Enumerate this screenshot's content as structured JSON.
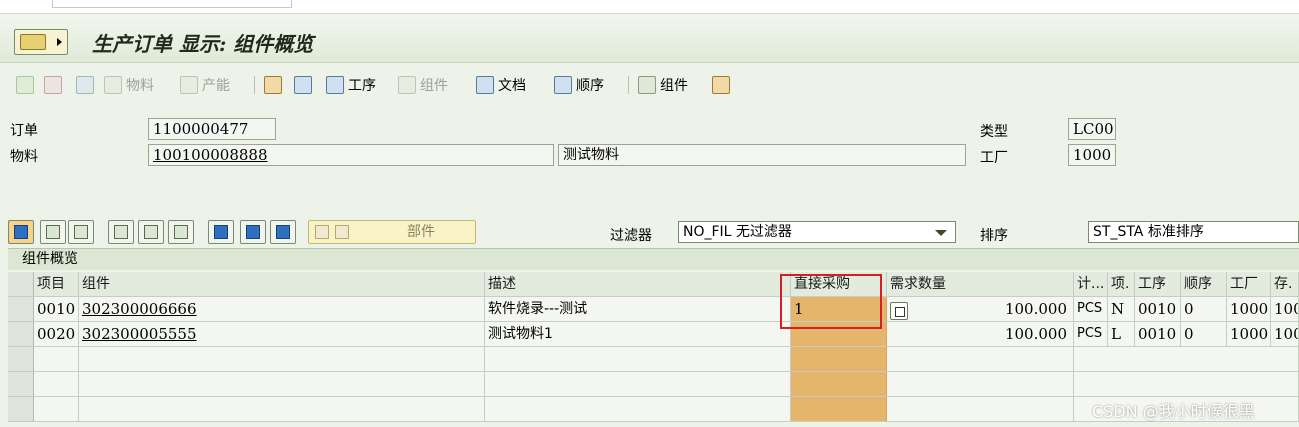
{
  "window": {
    "title": "生产订单 显示: 组件概览"
  },
  "toolbar": {
    "material_label": "物料",
    "capacity_label": "产能",
    "operation_label": "工序",
    "component_disabled_label": "组件",
    "document_label": "文档",
    "sequence_label": "顺序",
    "component_label": "组件"
  },
  "header": {
    "order_label": "订单",
    "order_value": "1100000477",
    "material_label": "物料",
    "material_value": "100100008888",
    "material_desc": "测试物料",
    "type_label": "类型",
    "type_value": "LC00",
    "plant_label": "工厂",
    "plant_value": "1000"
  },
  "grid_toolbar": {
    "parts_label": "部件",
    "filter_label": "过滤器",
    "filter_value": "NO_FIL 无过滤器",
    "sort_label": "排序",
    "sort_value": "ST_STA 标准排序"
  },
  "grid": {
    "title": "组件概览",
    "columns": [
      "项目",
      "组件",
      "描述",
      "直接采购",
      "需求数量",
      "计...",
      "项.",
      "工序",
      "顺序",
      "工厂",
      "存."
    ],
    "rows": [
      {
        "item": "0010",
        "component": "302300006666",
        "desc": "软件烧录---测试",
        "direct": "1",
        "qty": "100.000",
        "unit": "PCS",
        "cat": "N",
        "op": "0010",
        "seq": "0",
        "plant": "1000",
        "stor": "100"
      },
      {
        "item": "0020",
        "component": "302300005555",
        "desc": "测试物料1",
        "direct": "",
        "qty": "100.000",
        "unit": "PCS",
        "cat": "L",
        "op": "0010",
        "seq": "0",
        "plant": "1000",
        "stor": "100"
      }
    ]
  },
  "watermark": "CSDN @我小时候很黑"
}
